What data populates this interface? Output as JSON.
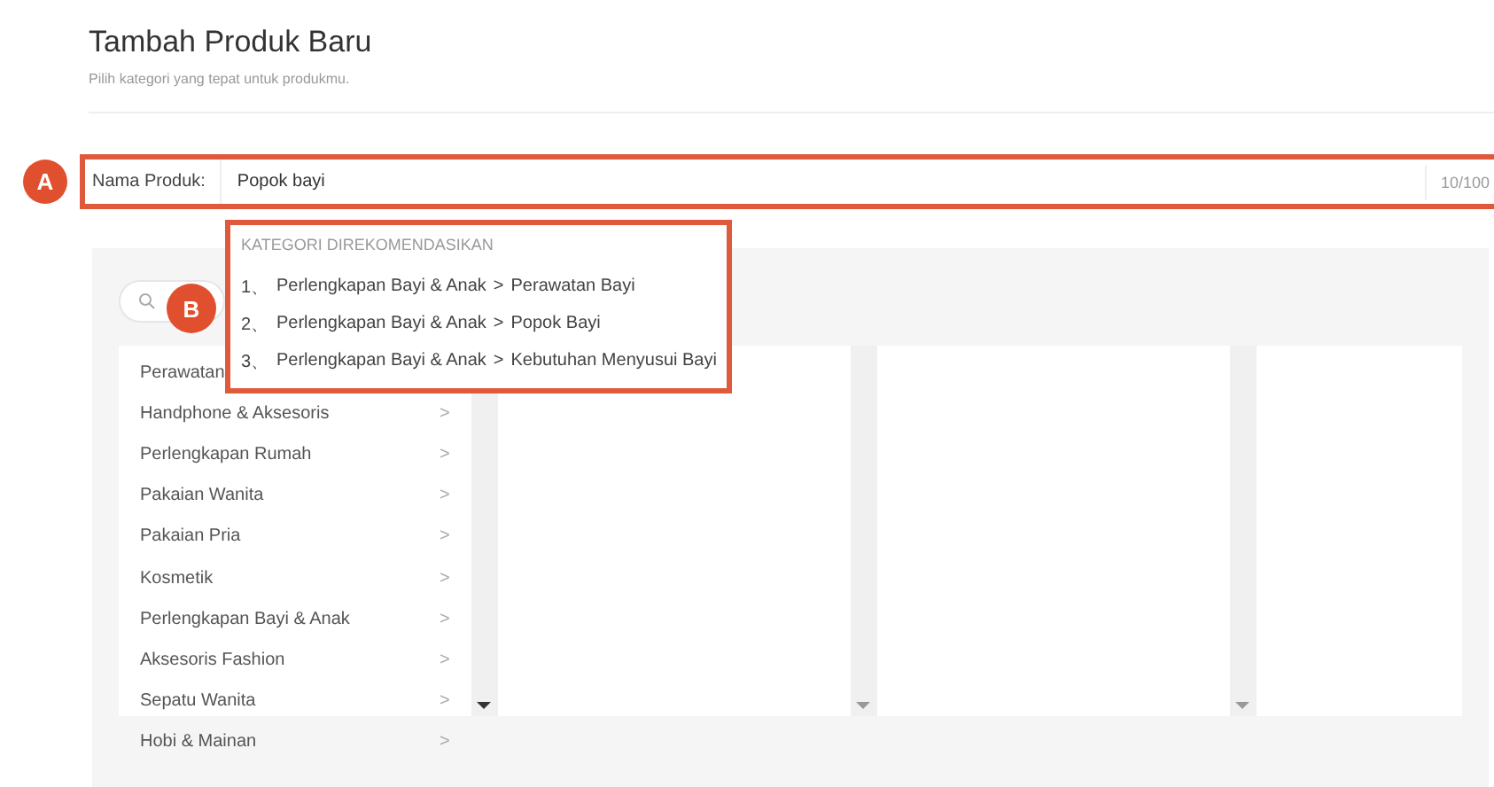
{
  "header": {
    "title": "Tambah Produk Baru",
    "subtitle": "Pilih kategori yang tepat untuk produkmu."
  },
  "product_name": {
    "badge": "A",
    "label": "Nama Produk:",
    "value": "Popok bayi",
    "counter": "10/100"
  },
  "recommendations": {
    "badge": "B",
    "heading": "KATEGORI DIREKOMENDASIKAN",
    "items": [
      {
        "number": "1、",
        "parent": "Perlengkapan Bayi & Anak",
        "separator": ">",
        "child": "Perawatan Bayi"
      },
      {
        "number": "2、",
        "parent": "Perlengkapan Bayi & Anak",
        "separator": ">",
        "child": "Popok Bayi"
      },
      {
        "number": "3、",
        "parent": "Perlengkapan Bayi & Anak",
        "separator": ">",
        "child": "Kebutuhan Menyusui Bayi"
      }
    ]
  },
  "categories": [
    {
      "label": "Perawatan"
    },
    {
      "label": "Handphone & Aksesoris",
      "chevron": ">"
    },
    {
      "label": "Perlengkapan Rumah",
      "chevron": ">"
    },
    {
      "label": "Pakaian Wanita",
      "chevron": ">"
    },
    {
      "label": "Pakaian Pria",
      "chevron": ">"
    },
    {
      "label": "Kosmetik",
      "chevron": ">"
    },
    {
      "label": "Perlengkapan Bayi & Anak",
      "chevron": ">"
    },
    {
      "label": "Aksesoris Fashion",
      "chevron": ">"
    },
    {
      "label": "Sepatu Wanita",
      "chevron": ">"
    },
    {
      "label": "Hobi & Mainan",
      "chevron": ">"
    }
  ]
}
